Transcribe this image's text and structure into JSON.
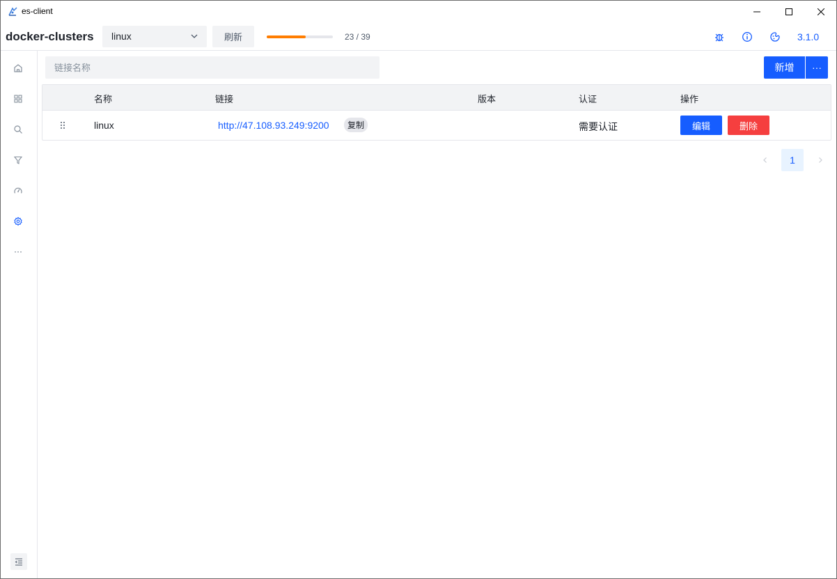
{
  "window": {
    "title": "es-client"
  },
  "header": {
    "app_name": "docker-clusters",
    "cluster_select": {
      "value": "linux"
    },
    "refresh_label": "刷新",
    "progress": {
      "current": 23,
      "total": 39,
      "text": "23 / 39",
      "percent": 59
    },
    "version": "3.1.0",
    "icons": [
      "bug-icon",
      "info-icon",
      "theme-icon"
    ]
  },
  "sidebar": {
    "items": [
      {
        "name": "home-icon",
        "active": false
      },
      {
        "name": "grid-icon",
        "active": false
      },
      {
        "name": "search-icon",
        "active": false
      },
      {
        "name": "filter-icon",
        "active": false
      },
      {
        "name": "dashboard-icon",
        "active": false
      },
      {
        "name": "settings-icon",
        "active": true
      },
      {
        "name": "more-icon",
        "active": false
      }
    ]
  },
  "toolbar": {
    "search_placeholder": "链接名称",
    "add_label": "新增",
    "more_label": "···"
  },
  "table": {
    "columns": [
      "名称",
      "链接",
      "版本",
      "认证",
      "操作"
    ],
    "rows": [
      {
        "name": "linux",
        "url": "http://47.108.93.249:9200",
        "copy_label": "复制",
        "version": "",
        "auth": "需要认证",
        "edit_label": "编辑",
        "delete_label": "删除"
      }
    ]
  },
  "pagination": {
    "current_page": "1"
  },
  "colors": {
    "primary": "#165dff",
    "danger": "#f53f3f",
    "progress": "#ff7d00"
  }
}
